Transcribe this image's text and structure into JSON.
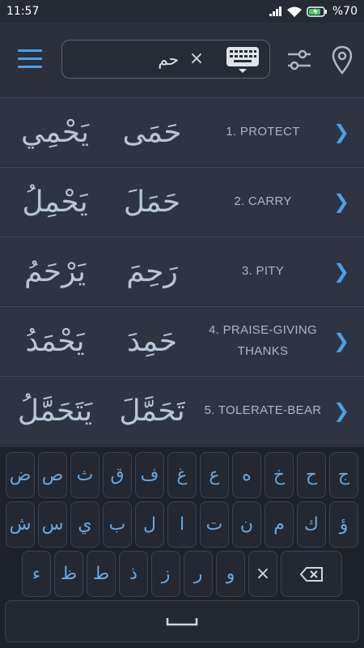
{
  "status_bar": {
    "time": "11:57",
    "battery": "%70"
  },
  "search": {
    "value": "حم",
    "clear_glyph": "×"
  },
  "results": [
    {
      "present": "يَحْمِي",
      "past": "حَمَى",
      "meaning": "1. PROTECT"
    },
    {
      "present": "يَحْمِلُ",
      "past": "حَمَلَ",
      "meaning": "2. CARRY"
    },
    {
      "present": "يَرْحَمُ",
      "past": "رَحِمَ",
      "meaning": "3. PITY"
    },
    {
      "present": "يَحْمَدُ",
      "past": "حَمِدَ",
      "meaning": "4. PRAISE-GIVING THANKS"
    },
    {
      "present": "يَتَحَمَّلُ",
      "past": "تَحَمَّلَ",
      "meaning": "5. TOLERATE-BEAR"
    }
  ],
  "chevron": "❯",
  "keyboard": {
    "row1": [
      "ض",
      "ص",
      "ث",
      "ق",
      "ف",
      "غ",
      "ع",
      "ه",
      "خ",
      "ح",
      "ج"
    ],
    "row2": [
      "ش",
      "س",
      "ي",
      "ب",
      "ل",
      "ا",
      "ت",
      "ن",
      "م",
      "ك",
      "ؤ"
    ],
    "row3": [
      "ء",
      "ظ",
      "ط",
      "ذ",
      "ز",
      "ر",
      "و",
      "×"
    ]
  },
  "icons": {
    "menu": "menu-icon",
    "keyboard": "keyboard-icon",
    "filter": "filter-icon",
    "location": "location-pin-icon",
    "backspace": "backspace-icon",
    "space": "space-icon",
    "chevron": "chevron-right-icon"
  },
  "colors": {
    "accent": "#4aa0e6",
    "background": "#2b303c",
    "row": "#2e3441",
    "keyboard": "#1e222b"
  }
}
